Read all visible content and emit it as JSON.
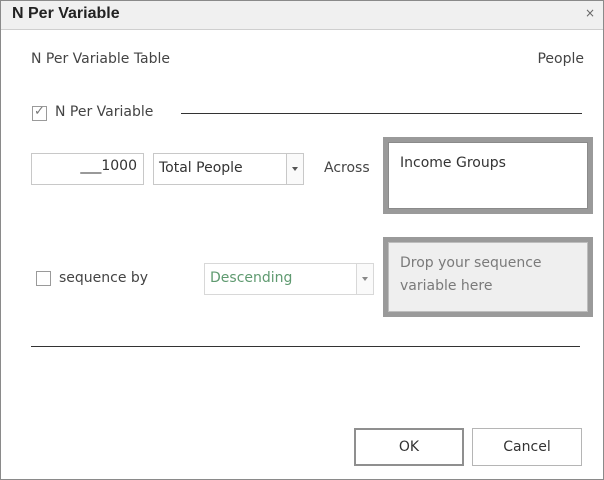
{
  "dialog": {
    "title": "N Per Variable",
    "close_glyph": "×"
  },
  "header": {
    "table_label": "N Per Variable Table",
    "people_label": "People"
  },
  "n_per_variable": {
    "checkbox_label": "N Per Variable",
    "checked": true,
    "check_glyph": "✓",
    "count_value": "___1000",
    "measure_selected": "Total People",
    "across_label": "Across",
    "across_variable": "Income Groups"
  },
  "sequence": {
    "checkbox_label": "sequence by",
    "checked": false,
    "order_selected": "Descending",
    "drop_placeholder": "Drop your sequence variable here"
  },
  "footer": {
    "ok_label": "OK",
    "cancel_label": "Cancel"
  },
  "colors": {
    "drop_border": "#9a9a9a",
    "disabled_text": "#5f9a70",
    "disabled_bg": "#efefef"
  }
}
